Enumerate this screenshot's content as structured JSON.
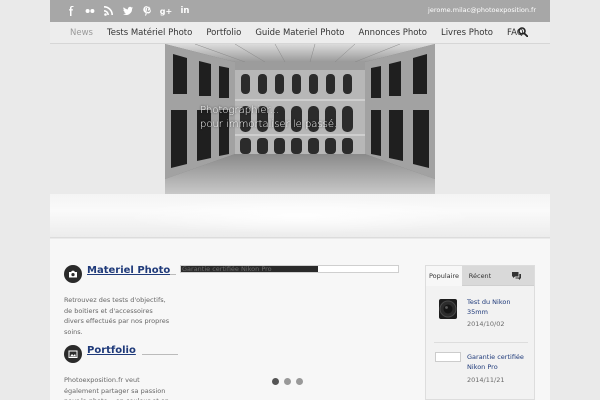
{
  "topbar": {
    "social_icons": [
      "facebook-icon",
      "flickr-icon",
      "rss-icon",
      "twitter-icon",
      "pinterest-icon",
      "google-plus-icon",
      "linkedin-icon"
    ],
    "email": "jerome.milac@photoexposition.fr"
  },
  "nav": {
    "items": [
      "News",
      "Tests Matériel Photo",
      "Portfolio",
      "Guide Materiel Photo",
      "Annonces Photo",
      "Livres Photo",
      "FAQ"
    ],
    "active": "News"
  },
  "hero": {
    "caption_line1": "Photographier...",
    "caption_line2": "pour immortaliser le passé."
  },
  "sidebar": {
    "blocks": [
      {
        "title": "Materiel Photo",
        "icon": "camera-icon",
        "text": "Retrouvez des tests d'objectifs, de boitiers et d'accessoires divers effectués par nos propres soins."
      },
      {
        "title": "Portfolio",
        "icon": "image-icon",
        "text": "Photoexposition.fr veut également partager sa passion pour la photo... en couleur et en"
      }
    ]
  },
  "progress": {
    "text": "Garantie certifiée Nikon Pro",
    "fraction": 0.63
  },
  "slider": {
    "dots": 3,
    "active_index": 0
  },
  "widget": {
    "tabs": [
      "Populaire",
      "Récent"
    ],
    "comments_icon": "comments-icon",
    "items": [
      {
        "title": "Test du Nikon 35mm",
        "date": "2014/10/02"
      },
      {
        "title": "Garantie certifiée Nikon Pro",
        "date": "2014/11/21"
      }
    ]
  }
}
